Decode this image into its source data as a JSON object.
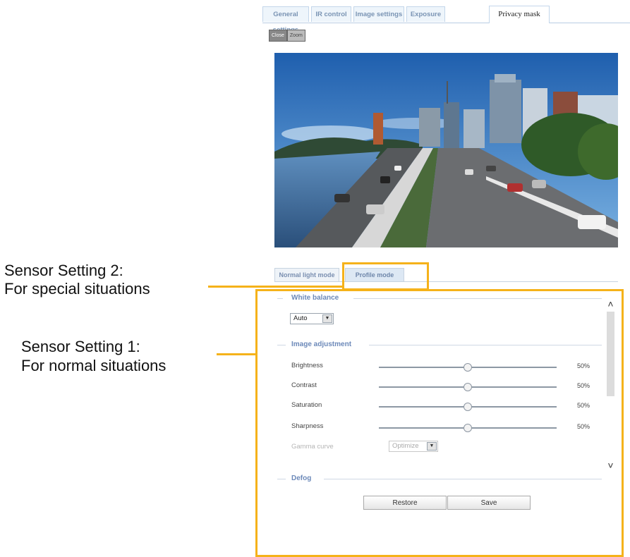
{
  "top_tabs": [
    "General settings",
    "IR control",
    "Image settings",
    "Exposure",
    "Privacy mask"
  ],
  "view_buttons": [
    "Close",
    "Zoom"
  ],
  "sub_tabs": [
    "Normal light mode",
    "Profile mode"
  ],
  "white_balance": {
    "legend": "White balance",
    "value": "Auto"
  },
  "image_adjustment": {
    "legend": "Image adjustment",
    "rows": [
      {
        "label": "Brightness",
        "value": "50%",
        "level": 0.5
      },
      {
        "label": "Contrast",
        "value": "50%",
        "level": 0.5
      },
      {
        "label": "Saturation",
        "value": "50%",
        "level": 0.5
      },
      {
        "label": "Sharpness",
        "value": "50%",
        "level": 0.5
      }
    ],
    "gamma": {
      "label": "Gamma curve",
      "value": "Optimize"
    }
  },
  "defog_legend": "Defog",
  "buttons": {
    "restore": "Restore",
    "save": "Save"
  },
  "annotations": {
    "setting2_line1": "Sensor Setting 2:",
    "setting2_line2": "For special situations",
    "setting1_line1": "Sensor Setting 1:",
    "setting1_line2": "For normal situations"
  },
  "colors": {
    "highlight": "#f5b21a",
    "legend_text": "#6c89b9"
  }
}
